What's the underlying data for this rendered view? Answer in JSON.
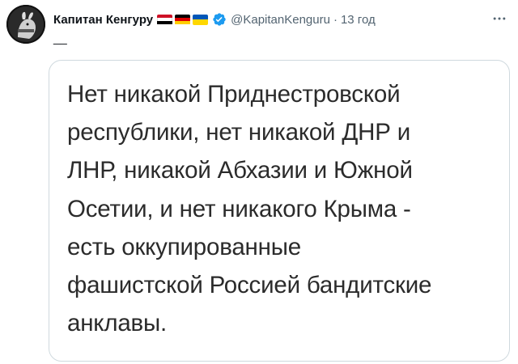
{
  "author": {
    "display_name": "Капитан Кенгуру",
    "handle": "@KapitanKenguru",
    "separator": "·",
    "time": "13 год",
    "avatar_icon": "kangaroo-avatar-icon",
    "verified_icon": "verified-badge-icon",
    "flags": [
      {
        "name": "egypt-flag-icon",
        "stripes": [
          "#ce1126",
          "#ffffff",
          "#000000"
        ]
      },
      {
        "name": "germany-flag-icon",
        "stripes": [
          "#000000",
          "#dd0000",
          "#ffce00"
        ]
      },
      {
        "name": "ukraine-flag-icon",
        "stripes": [
          "#0057b7",
          "#ffd700"
        ]
      }
    ]
  },
  "menu": {
    "icon": "more-options-icon"
  },
  "tweet": {
    "text": "__"
  },
  "card": {
    "lines": [
      "Нет никакой Приднестровской",
      "республики, нет никакой ДНР и",
      "ЛНР, никакой Абхазии и Южной",
      "Осетии, и нет никакого Крыма -",
      "есть оккупированные",
      "фашистской Россией бандитские",
      "анклавы."
    ]
  },
  "colors": {
    "text_primary": "#0f1419",
    "text_secondary": "#536471",
    "border": "#cfd9de",
    "verified": "#1d9bf0"
  }
}
